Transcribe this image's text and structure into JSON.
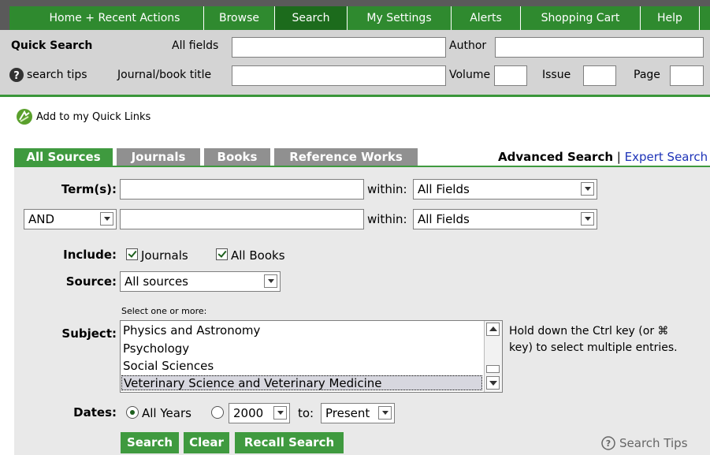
{
  "nav": {
    "items": [
      "Home + Recent Actions",
      "Browse",
      "Search",
      "My Settings",
      "Alerts",
      "Shopping Cart",
      "Help"
    ],
    "active": "Search"
  },
  "quick_search": {
    "title": "Quick Search",
    "all_fields_label": "All fields",
    "author_label": "Author",
    "search_tips_label": "search tips",
    "journal_label": "Journal/book title",
    "volume_label": "Volume",
    "issue_label": "Issue",
    "page_label": "Page"
  },
  "quick_links": "Add to my Quick Links",
  "tabs": [
    "All Sources",
    "Journals",
    "Books",
    "Reference Works"
  ],
  "mode_links": {
    "advanced": "Advanced Search",
    "separator": "|",
    "expert": "Expert Search"
  },
  "form": {
    "terms_label": "Term(s):",
    "within_label": "within:",
    "within_value_1": "All Fields",
    "within_value_2": "All Fields",
    "operator": "AND",
    "include_label": "Include:",
    "include_journals": "Journals",
    "include_books": "All Books",
    "source_label": "Source:",
    "source_value": "All sources",
    "select_hint": "Select one or more:",
    "subject_label": "Subject:",
    "subjects": [
      "Physics and Astronomy",
      "Psychology",
      "Social Sciences",
      "Veterinary Science and Veterinary Medicine"
    ],
    "selected_subject": "Veterinary Science and Veterinary Medicine",
    "ctrl_hint_1": "Hold down the Ctrl key (or ⌘",
    "ctrl_hint_2": "key) to select multiple entries.",
    "dates_label": "Dates:",
    "all_years": "All Years",
    "year_from": "2000",
    "to_label": "to:",
    "year_to": "Present"
  },
  "buttons": {
    "search": "Search",
    "clear": "Clear",
    "recall": "Recall Search"
  },
  "search_tips_link": "Search Tips",
  "colors": {
    "green": "#3f9a3f",
    "dark_green": "#1c6b1c",
    "nav_bg": "#5a5a5a",
    "gray_tab": "#909090",
    "form_bg": "#e9e9e9"
  }
}
